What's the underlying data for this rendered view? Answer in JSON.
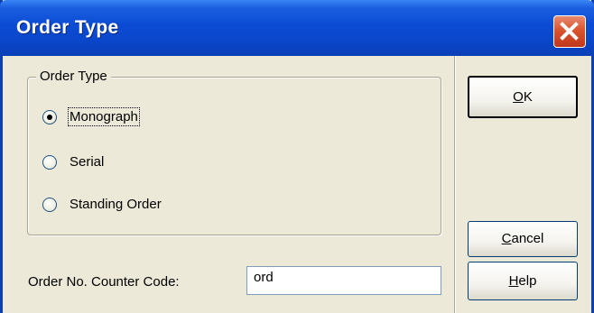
{
  "window": {
    "title": "Order Type"
  },
  "group": {
    "legend": "Order Type",
    "options": [
      {
        "label": "Monograph",
        "selected": true
      },
      {
        "label": "Serial",
        "selected": false
      },
      {
        "label": "Standing Order",
        "selected": false
      }
    ]
  },
  "counter": {
    "label": "Order No. Counter Code:",
    "value": "ord"
  },
  "buttons": {
    "ok": {
      "mnemonic": "O",
      "rest": "K"
    },
    "cancel": {
      "mnemonic": "C",
      "rest": "ancel"
    },
    "help": {
      "mnemonic": "H",
      "rest": "elp"
    }
  },
  "icons": {
    "close": "close-x-icon",
    "radio": "radio-button"
  },
  "colors": {
    "titlebar": "#0a47cc",
    "face": "#ece9d8",
    "close": "#d9542f"
  }
}
